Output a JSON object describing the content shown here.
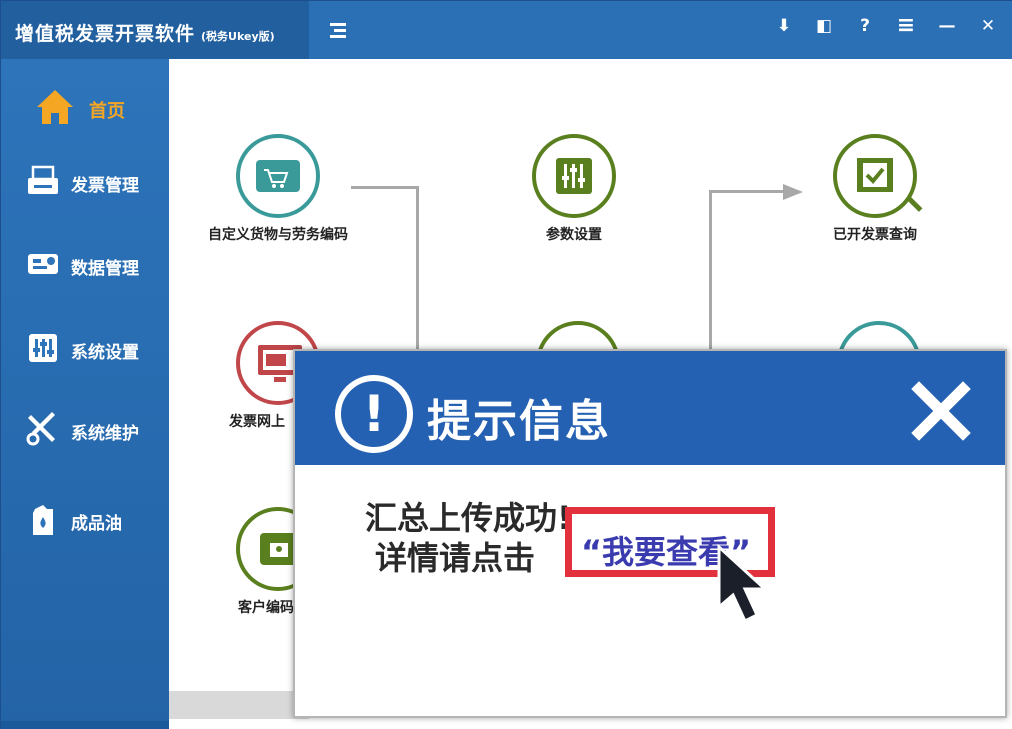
{
  "window": {
    "title": "增值税发票开票软件",
    "edition": "(税务Ukey版)"
  },
  "titlebar": {
    "buttons": [
      {
        "name": "download-icon",
        "glyph": "⬇"
      },
      {
        "name": "window-layout-icon",
        "glyph": "◧"
      },
      {
        "name": "help-icon",
        "glyph": "?"
      },
      {
        "name": "menu-icon",
        "glyph": "≡"
      },
      {
        "name": "minimize-icon",
        "glyph": "—"
      },
      {
        "name": "close-icon",
        "glyph": "✕"
      }
    ]
  },
  "sidebar": {
    "items": [
      {
        "label": "首页",
        "icon": "home-icon",
        "active": true
      },
      {
        "label": "发票管理",
        "icon": "printer-icon"
      },
      {
        "label": "数据管理",
        "icon": "data-icon"
      },
      {
        "label": "系统设置",
        "icon": "sliders-icon"
      },
      {
        "label": "系统维护",
        "icon": "tools-icon"
      },
      {
        "label": "成品油",
        "icon": "oil-can-icon"
      }
    ]
  },
  "features": [
    {
      "label": "自定义货物与劳务编码",
      "icon": "wallet-cart-icon",
      "color": "#3a9a9a"
    },
    {
      "label": "参数设置",
      "icon": "sliders-icon",
      "color": "#5a7f1e"
    },
    {
      "label": "已开发票查询",
      "icon": "film-check-icon",
      "color": "#5a7f1e"
    },
    {
      "label": "发票网上",
      "icon": "monitor-icon",
      "color": "#c0464a"
    },
    {
      "label": "客户编码",
      "icon": "wallet-icon",
      "color": "#5a7f1e"
    }
  ],
  "dialog": {
    "title": "提示信息",
    "line1": "汇总上传成功!",
    "line2": "详情请点击",
    "link": "“我要查看”",
    "colors": {
      "header": "#2561b3",
      "highlight": "#e2303c",
      "link": "#3b3bb0"
    }
  }
}
